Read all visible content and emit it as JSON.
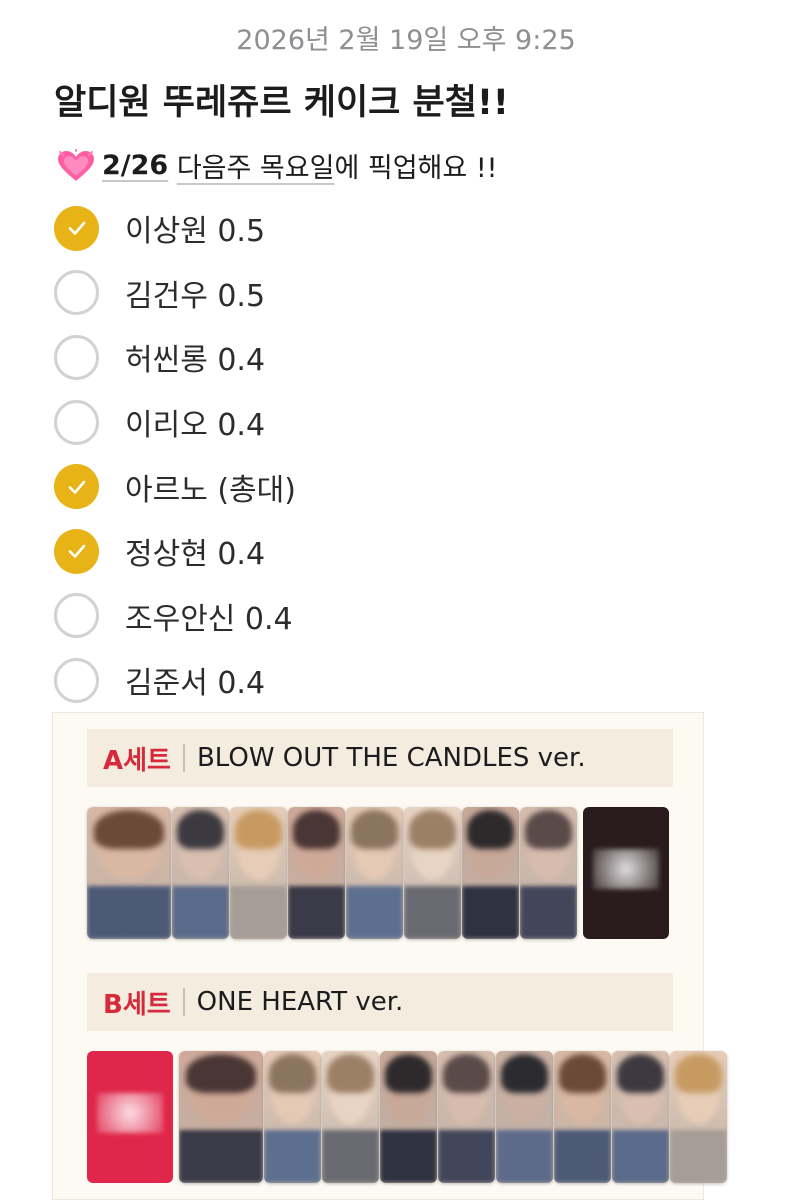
{
  "header": {
    "timestamp": "2026년 2월 19일 오후 9:25",
    "title": "알디원 뚜레쥬르 케이크 분철!!"
  },
  "note": {
    "icon": "sparkling-heart-icon",
    "date": "2/26",
    "day": "다음주 목요일",
    "rest": "에 픽업해요 !!"
  },
  "checklist": [
    {
      "label": "이상원 0.5",
      "checked": true
    },
    {
      "label": "김건우 0.5",
      "checked": false
    },
    {
      "label": "허씬롱 0.4",
      "checked": false
    },
    {
      "label": "이리오 0.4",
      "checked": false
    },
    {
      "label": "아르노 (총대)",
      "checked": true
    },
    {
      "label": "정상현 0.4",
      "checked": true
    },
    {
      "label": "조우안신 0.4",
      "checked": false
    },
    {
      "label": "김준서 0.4",
      "checked": false
    }
  ],
  "colors": {
    "check_done": "#e8b316",
    "check_open_border": "#d1d1d6",
    "set_tag": "#d62a3c",
    "promo_a": "#2a1c1e",
    "promo_b": "#e0264a"
  },
  "poster": {
    "set_a": {
      "tag": "A세트",
      "name": "BLOW OUT THE CANDLES ver."
    },
    "set_b": {
      "tag": "B세트",
      "name": "ONE HEART ver."
    }
  }
}
